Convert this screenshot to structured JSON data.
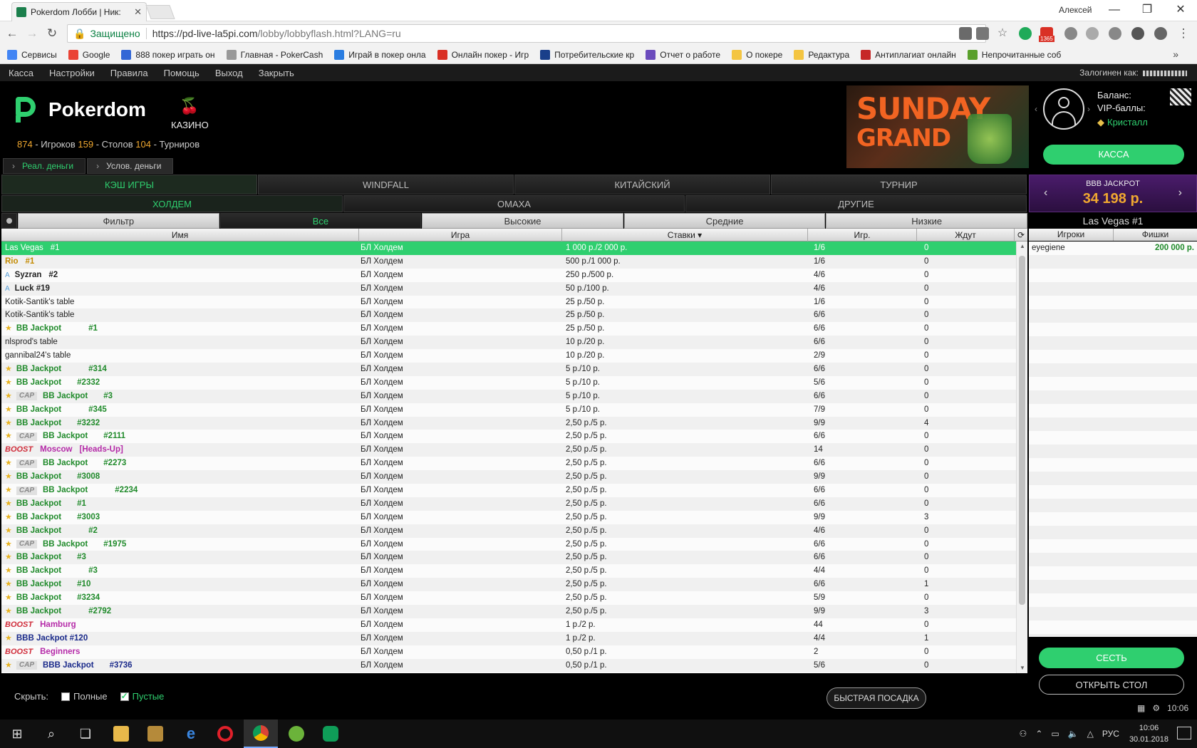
{
  "browser": {
    "tab_title": "Pokerdom Лобби | Ник:",
    "window_user": "Алексей",
    "secure_label": "Защищено",
    "url_main": "https://pd-live-la5pi.com",
    "url_path": "/lobby/lobbyflash.html?LANG=ru",
    "ext_badge": "1365",
    "bookmarks": [
      {
        "label": "Сервисы",
        "color": "#4285f4"
      },
      {
        "label": "Google",
        "color": "#ea4335"
      },
      {
        "label": "888 покер играть он",
        "color": "#3367d6"
      },
      {
        "label": "Главная - PokerCash",
        "color": "#999999"
      },
      {
        "label": "Играй в покер онла",
        "color": "#2a7de1"
      },
      {
        "label": "Онлайн покер - Игр",
        "color": "#d93025"
      },
      {
        "label": "Потребительские кр",
        "color": "#1a3f8a"
      },
      {
        "label": "Отчет о работе",
        "color": "#6b4bbd"
      },
      {
        "label": "О покере",
        "color": "#f4c542"
      },
      {
        "label": "Редактура",
        "color": "#f4c542"
      },
      {
        "label": "Антиплагиат онлайн",
        "color": "#c62828"
      },
      {
        "label": "Непрочитанные соб",
        "color": "#5aa02c"
      }
    ]
  },
  "menu": {
    "items": [
      "Касса",
      "Настройки",
      "Правила",
      "Помощь",
      "Выход",
      "Закрыть"
    ],
    "logged_in": "Залогинен как:"
  },
  "header": {
    "brand": "Pokerdom",
    "casino": "КАЗИНО",
    "stats": {
      "players": "874",
      "players_label": " - Игроков ",
      "tables": "159",
      "tables_label": " - Столов ",
      "tournaments": "104",
      "tournaments_label": " - Турниров"
    },
    "money_tabs": [
      "Реал. деньги",
      "Услов. деньги"
    ],
    "banner": {
      "line1": "SUNDAY",
      "line2": "GRAND"
    },
    "account": {
      "balance": "Баланс:",
      "vip": "VIP-баллы:",
      "tier": "Кристалл",
      "kassa": "КАССА"
    }
  },
  "type_tabs": [
    "КЭШ ИГРЫ",
    "WINDFALL",
    "КИТАЙСКИЙ",
    "ТУРНИР"
  ],
  "sub_tabs": [
    "ХОЛДЕМ",
    "ОМАХА",
    "ДРУГИЕ"
  ],
  "filter_tabs": [
    "Фильтр",
    "Все",
    "Высокие",
    "Средние",
    "Низкие"
  ],
  "columns": {
    "name": "Имя",
    "game": "Игра",
    "stakes": "Ставки ▾",
    "players": "Игр.",
    "waiting": "Ждут"
  },
  "tables": [
    {
      "prefix": "",
      "name": "Las Vegas",
      "num": "#1",
      "style": "plain",
      "game": "БЛ Холдем",
      "stakes": "1 000 р./2 000 р.",
      "players": "1/6",
      "waiting": "0"
    },
    {
      "prefix": "",
      "name": "Rio",
      "num": "#1",
      "style": "gold",
      "game": "БЛ Холдем",
      "stakes": "500 р./1 000 р.",
      "players": "1/6",
      "waiting": "0"
    },
    {
      "prefix": "A",
      "name": "Syzran",
      "num": "#2",
      "style": "dark",
      "game": "БЛ Холдем",
      "stakes": "250 р./500 р.",
      "players": "4/6",
      "waiting": "0"
    },
    {
      "prefix": "A",
      "name": "Luck #19",
      "num": "",
      "style": "dark",
      "game": "БЛ Холдем",
      "stakes": "50 р./100 р.",
      "players": "4/6",
      "waiting": "0"
    },
    {
      "prefix": "",
      "name": "Kotik-Santik's table",
      "num": "",
      "style": "plain",
      "game": "БЛ Холдем",
      "stakes": "25 р./50 р.",
      "players": "1/6",
      "waiting": "0"
    },
    {
      "prefix": "",
      "name": "Kotik-Santik's table",
      "num": "",
      "style": "plain",
      "game": "БЛ Холдем",
      "stakes": "25 р./50 р.",
      "players": "6/6",
      "waiting": "0"
    },
    {
      "prefix": "star",
      "name": "BB Jackpot",
      "num": "#1",
      "style": "bbj",
      "game": "БЛ Холдем",
      "stakes": "25 р./50 р.",
      "players": "6/6",
      "waiting": "0"
    },
    {
      "prefix": "",
      "name": "nlsprod's table",
      "num": "",
      "style": "plain",
      "game": "БЛ Холдем",
      "stakes": "10 р./20 р.",
      "players": "6/6",
      "waiting": "0"
    },
    {
      "prefix": "",
      "name": "gannibal24's table",
      "num": "",
      "style": "plain",
      "game": "БЛ Холдем",
      "stakes": "10 р./20 р.",
      "players": "2/9",
      "waiting": "0"
    },
    {
      "prefix": "star",
      "name": "BB Jackpot",
      "num": "#314",
      "style": "bbj",
      "game": "БЛ Холдем",
      "stakes": "5 р./10 р.",
      "players": "6/6",
      "waiting": "0"
    },
    {
      "prefix": "star",
      "name": "BB Jackpot",
      "num": "#2332",
      "style": "bbj",
      "game": "БЛ Холдем",
      "stakes": "5 р./10 р.",
      "players": "5/6",
      "waiting": "0"
    },
    {
      "prefix": "cap",
      "name": "BB Jackpot",
      "num": "#3",
      "style": "bbj",
      "game": "БЛ Холдем",
      "stakes": "5 р./10 р.",
      "players": "6/6",
      "waiting": "0"
    },
    {
      "prefix": "star",
      "name": "BB Jackpot",
      "num": "#345",
      "style": "bbj",
      "game": "БЛ Холдем",
      "stakes": "5 р./10 р.",
      "players": "7/9",
      "waiting": "0"
    },
    {
      "prefix": "star",
      "name": "BB Jackpot",
      "num": "#3232",
      "style": "bbj",
      "game": "БЛ Холдем",
      "stakes": "2,50 р./5 р.",
      "players": "9/9",
      "waiting": "4"
    },
    {
      "prefix": "cap",
      "name": "BB Jackpot",
      "num": "#2111",
      "style": "bbj",
      "game": "БЛ Холдем",
      "stakes": "2,50 р./5 р.",
      "players": "6/6",
      "waiting": "0"
    },
    {
      "prefix": "boost",
      "name": "Moscow",
      "num": "[Heads-Up]",
      "style": "boost",
      "game": "БЛ Холдем",
      "stakes": "2,50 р./5 р.",
      "players": "14",
      "waiting": "0"
    },
    {
      "prefix": "cap",
      "name": "BB Jackpot",
      "num": "#2273",
      "style": "bbj",
      "game": "БЛ Холдем",
      "stakes": "2,50 р./5 р.",
      "players": "6/6",
      "waiting": "0"
    },
    {
      "prefix": "star",
      "name": "BB Jackpot",
      "num": "#3008",
      "style": "bbj",
      "game": "БЛ Холдем",
      "stakes": "2,50 р./5 р.",
      "players": "9/9",
      "waiting": "0"
    },
    {
      "prefix": "cap",
      "name": "BB Jackpot",
      "num": "#2234",
      "style": "bbj",
      "game": "БЛ Холдем",
      "stakes": "2,50 р./5 р.",
      "players": "6/6",
      "waiting": "0"
    },
    {
      "prefix": "star",
      "name": "BB Jackpot",
      "num": "#1",
      "style": "bbj",
      "game": "БЛ Холдем",
      "stakes": "2,50 р./5 р.",
      "players": "6/6",
      "waiting": "0"
    },
    {
      "prefix": "star",
      "name": "BB Jackpot",
      "num": "#3003",
      "style": "bbj",
      "game": "БЛ Холдем",
      "stakes": "2,50 р./5 р.",
      "players": "9/9",
      "waiting": "3"
    },
    {
      "prefix": "star",
      "name": "BB Jackpot",
      "num": "#2",
      "style": "bbj",
      "game": "БЛ Холдем",
      "stakes": "2,50 р./5 р.",
      "players": "4/6",
      "waiting": "0"
    },
    {
      "prefix": "cap",
      "name": "BB Jackpot",
      "num": "#1975",
      "style": "bbj",
      "game": "БЛ Холдем",
      "stakes": "2,50 р./5 р.",
      "players": "6/6",
      "waiting": "0"
    },
    {
      "prefix": "star",
      "name": "BB Jackpot",
      "num": "#3",
      "style": "bbj",
      "game": "БЛ Холдем",
      "stakes": "2,50 р./5 р.",
      "players": "6/6",
      "waiting": "0"
    },
    {
      "prefix": "star",
      "name": "BB Jackpot",
      "num": "#3",
      "style": "bbj",
      "game": "БЛ Холдем",
      "stakes": "2,50 р./5 р.",
      "players": "4/4",
      "waiting": "0"
    },
    {
      "prefix": "star",
      "name": "BB Jackpot",
      "num": "#10",
      "style": "bbj",
      "game": "БЛ Холдем",
      "stakes": "2,50 р./5 р.",
      "players": "6/6",
      "waiting": "1"
    },
    {
      "prefix": "star",
      "name": "BB Jackpot",
      "num": "#3234",
      "style": "bbj",
      "game": "БЛ Холдем",
      "stakes": "2,50 р./5 р.",
      "players": "5/9",
      "waiting": "0"
    },
    {
      "prefix": "star",
      "name": "BB Jackpot",
      "num": "#2792",
      "style": "bbj",
      "game": "БЛ Холдем",
      "stakes": "2,50 р./5 р.",
      "players": "9/9",
      "waiting": "3"
    },
    {
      "prefix": "boost",
      "name": "Hamburg",
      "num": "",
      "style": "boost",
      "game": "БЛ Холдем",
      "stakes": "1 р./2 р.",
      "players": "44",
      "waiting": "0"
    },
    {
      "prefix": "star",
      "name": "BBB Jackpot #120",
      "num": "",
      "style": "bbbj",
      "game": "БЛ Холдем",
      "stakes": "1 р./2 р.",
      "players": "4/4",
      "waiting": "1"
    },
    {
      "prefix": "boost",
      "name": "Beginners",
      "num": "",
      "style": "boost",
      "game": "БЛ Холдем",
      "stakes": "0,50 р./1 р.",
      "players": "2",
      "waiting": "0"
    },
    {
      "prefix": "cap",
      "name": "BBB Jackpot",
      "num": "#3736",
      "style": "bbbj",
      "game": "БЛ Холдем",
      "stakes": "0,50 р./1 р.",
      "players": "5/6",
      "waiting": "0"
    }
  ],
  "badges": {
    "cap": "CAP",
    "boost": "BOOST"
  },
  "jackpot": {
    "title": "BBB JACKPOT",
    "value": "34 198 р."
  },
  "right_panel": {
    "table_title": "Las Vegas  #1",
    "col_players": "Игроки",
    "col_chips": "Фишки",
    "players": [
      {
        "name": "eyegiene",
        "chips": "200 000 р."
      }
    ],
    "sit": "СЕСТЬ",
    "open_table": "ОТКРЫТЬ СТОЛ"
  },
  "bottom": {
    "hide_label": "Скрыть:",
    "full_label": "Полные",
    "empty_label": "Пустые",
    "full_checked": false,
    "empty_checked": true,
    "quick_seat": "БЫСТРАЯ ПОСАДКА",
    "time": "10:06"
  },
  "taskbar": {
    "lang": "РУС",
    "time": "10:06",
    "date": "30.01.2018"
  }
}
